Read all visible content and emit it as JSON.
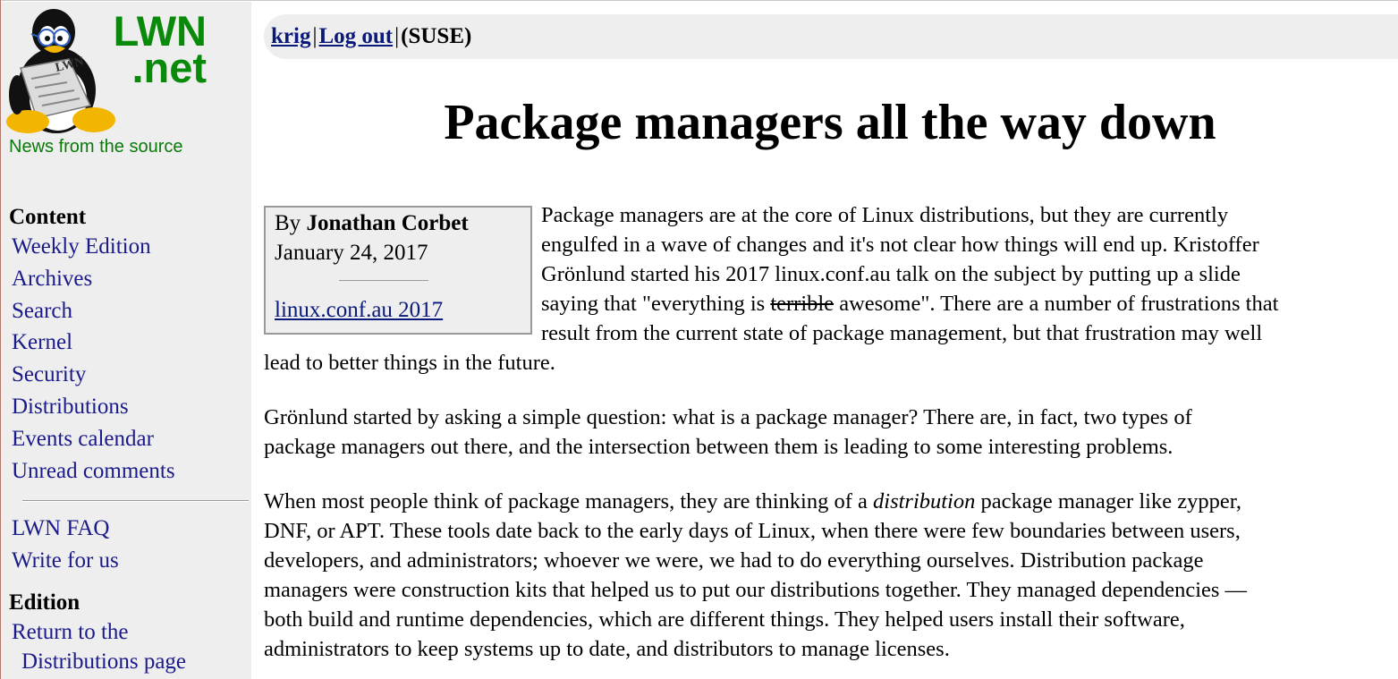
{
  "site": {
    "logo_word1": "LWN",
    "logo_word2": ".net",
    "logo_badge": "LWN",
    "tagline": "News from the source"
  },
  "sidebar": {
    "content_heading": "Content",
    "content_items": [
      {
        "label": "Weekly Edition"
      },
      {
        "label": "Archives"
      },
      {
        "label": "Search"
      },
      {
        "label": "Kernel"
      },
      {
        "label": "Security"
      },
      {
        "label": "Distributions"
      },
      {
        "label": "Events calendar"
      },
      {
        "label": "Unread comments"
      }
    ],
    "extra_items": [
      {
        "label": "LWN FAQ"
      },
      {
        "label": "Write for us"
      }
    ],
    "edition_heading": "Edition",
    "edition_link_line1": "Return to the",
    "edition_link_line2": "Distributions page"
  },
  "userbar": {
    "username": "krig",
    "sep1": "|",
    "logout": "Log out",
    "sep2": "|",
    "org": "(SUSE)"
  },
  "article": {
    "title": "Package managers all the way down",
    "byline_prefix": "By",
    "author": "Jonathan Corbet",
    "date": "January 24, 2017",
    "event_link": "linux.conf.au 2017",
    "p1_lines": [
      "Package managers are at the core of Linux distributions, but they are currently",
      "engulfed in a wave of changes and it's not clear how things will end up. Kristoffer",
      "Grönlund started his 2017 linux.conf.au talk on the subject by putting up a slide"
    ],
    "p1_line4_pre": "saying that \"everything is ",
    "p1_line4_struck": "terrible",
    "p1_line4_post": " awesome\". There are a number of frustrations that",
    "p1_line5": "result from the current state of package management, but that frustration may well",
    "p1_line6": "lead to better things in the future.",
    "p2_lines": [
      "Grönlund started by asking a simple question: what is a package manager? There are, in fact, two types of",
      "package managers out there, and the intersection between them is leading to some interesting problems."
    ],
    "p3_line1_pre": "When most people think of package managers, they are thinking of a ",
    "p3_line1_em": "distribution",
    "p3_line1_post": " package manager like zypper,",
    "p3_lines": [
      "DNF, or APT. These tools date back to the early days of Linux, when there were few boundaries between users,",
      "developers, and administrators; whoever we were, we had to do everything ourselves. Distribution package",
      "managers were construction kits that helped us to put our distributions together. They managed dependencies —",
      "both build and runtime dependencies, which are different things. They helped users install their software,",
      "administrators to keep systems up to date, and distributors to manage licenses."
    ]
  },
  "colors": {
    "logo_green": "#0a8a0a",
    "link_blue": "#1a1a8a",
    "sidebar_bg": "#eeeeee"
  }
}
